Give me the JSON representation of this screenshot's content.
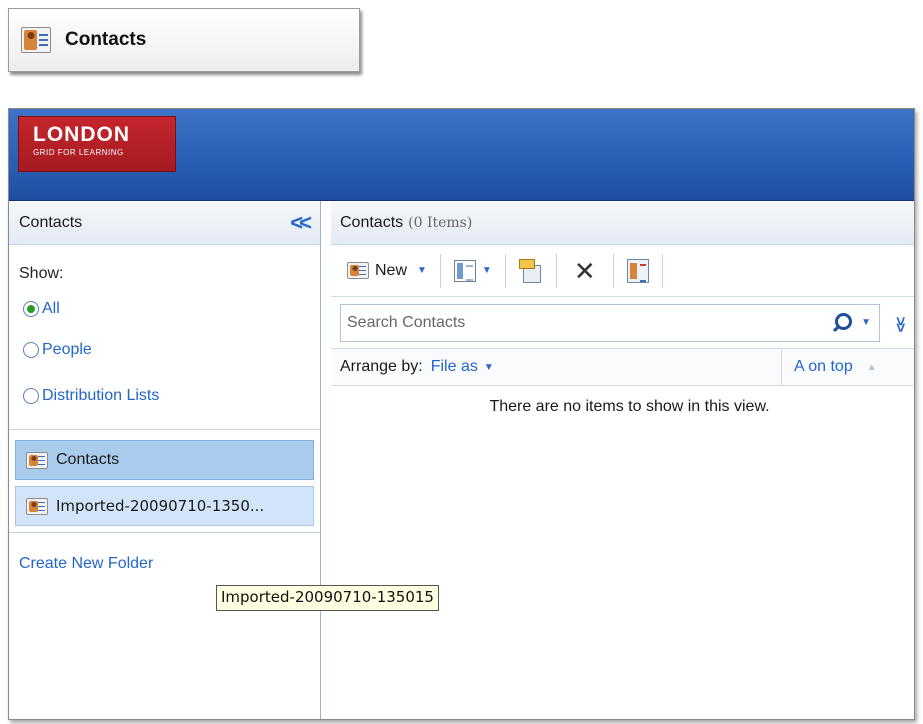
{
  "top_banner": {
    "label": "Contacts",
    "icon": "contact-card-icon"
  },
  "header": {
    "logo_line1": "LONDON",
    "logo_line2": "GRID FOR LEARNING",
    "color": "#2a5fb5"
  },
  "nav": {
    "title": "Contacts",
    "collapse_icon": "double-chevron-left-icon",
    "show_label": "Show:",
    "filters": [
      {
        "label": "All",
        "checked": true
      },
      {
        "label": "People",
        "checked": false
      },
      {
        "label": "Distribution Lists",
        "checked": false
      }
    ],
    "folders": [
      {
        "label": "Contacts",
        "selected": true
      },
      {
        "label": "Imported-20090710-1350...",
        "selected": false
      }
    ],
    "create_folder": "Create New Folder"
  },
  "tooltip": {
    "text": "Imported-20090710-135015"
  },
  "content": {
    "title": "Contacts",
    "count": "(0 Items)",
    "toolbar": {
      "new_label": "New",
      "icons": [
        "contact-card-icon",
        "view-columns-icon",
        "move-to-folder-icon",
        "delete-icon",
        "address-book-icon"
      ]
    },
    "search": {
      "placeholder": "Search Contacts"
    },
    "arrange": {
      "label": "Arrange by:",
      "value": "File as",
      "sort": "A on top"
    },
    "empty_message": "There are no items to show in this view."
  },
  "colors": {
    "accent": "#2266cc",
    "selected": "#a9cbec",
    "logo": "#c4262c"
  }
}
